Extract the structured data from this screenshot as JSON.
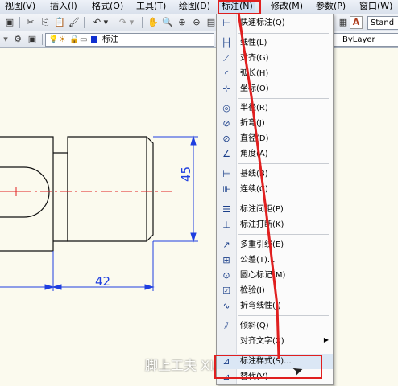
{
  "menubar": {
    "items": [
      {
        "label": "视图(V)"
      },
      {
        "label": "插入(I)"
      },
      {
        "label": "格式(O)"
      },
      {
        "label": "工具(T)"
      },
      {
        "label": "绘图(D)"
      },
      {
        "label": "标注(N)"
      },
      {
        "label": "修改(M)"
      },
      {
        "label": "参数(P)"
      },
      {
        "label": "窗口(W)"
      }
    ]
  },
  "toolbar": {
    "style_label": "Stand",
    "dimstyle_label": "标注",
    "layer_label": "ByLayer"
  },
  "drawing": {
    "dim_vertical": "45",
    "dim_horizontal": "42"
  },
  "dropdown": {
    "items": [
      {
        "label": "快速标注(Q)",
        "icon": "quick-dimension-icon"
      },
      {
        "label": "线性(L)",
        "icon": "linear-icon"
      },
      {
        "label": "对齐(G)",
        "icon": "aligned-icon"
      },
      {
        "label": "弧长(H)",
        "icon": "arc-length-icon"
      },
      {
        "label": "坐标(O)",
        "icon": "ordinate-icon"
      },
      {
        "label": "半径(R)",
        "icon": "radius-icon"
      },
      {
        "label": "折弯(J)",
        "icon": "jogged-icon"
      },
      {
        "label": "直径(D)",
        "icon": "diameter-icon"
      },
      {
        "label": "角度(A)",
        "icon": "angular-icon"
      },
      {
        "label": "基线(B)",
        "icon": "baseline-icon"
      },
      {
        "label": "连续(C)",
        "icon": "continue-icon"
      },
      {
        "label": "标注间距(P)",
        "icon": "dimension-space-icon"
      },
      {
        "label": "标注打断(K)",
        "icon": "dimension-break-icon"
      },
      {
        "label": "多重引线(E)",
        "icon": "multileader-icon"
      },
      {
        "label": "公差(T)...",
        "icon": "tolerance-icon"
      },
      {
        "label": "圆心标记(M)",
        "icon": "center-mark-icon"
      },
      {
        "label": "检验(I)",
        "icon": "inspection-icon"
      },
      {
        "label": "折弯线性(J)",
        "icon": "jogged-linear-icon"
      },
      {
        "label": "倾斜(Q)",
        "icon": "oblique-icon"
      },
      {
        "label": "对齐文字(X)",
        "icon": ""
      },
      {
        "label": "标注样式(S)...",
        "icon": "dimension-style-icon"
      },
      {
        "label": "替代(V)",
        "icon": "override-icon"
      }
    ]
  },
  "watermark": "脚上工夫 XIAOSHITM.COM",
  "colors": {
    "highlight": "#e01f1f",
    "dimension": "#1f3fe0",
    "centerline": "#e02020",
    "geometry": "#111111"
  }
}
